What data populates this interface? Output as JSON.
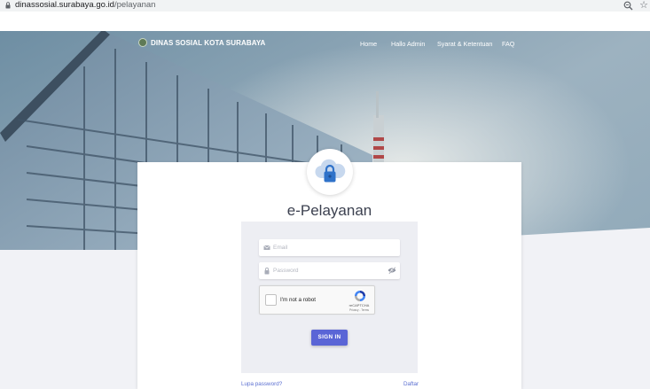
{
  "browser": {
    "url_host": "dinassosial.surabaya.go.id",
    "url_path": "/pelayanan",
    "icons": {
      "lock": "lock-icon",
      "zoom": "zoom-icon",
      "bookmark": "star-icon"
    }
  },
  "navbar": {
    "brand": "DINAS SOSIAL KOTA SURABAYA",
    "items": [
      "Home",
      "Hallo Admin",
      "Syarat & Ketentuan",
      "FAQ"
    ]
  },
  "login": {
    "logo_icon": "cloud-lock-icon",
    "title": "e-Pelayanan",
    "email_placeholder": "Email",
    "password_placeholder": "Password",
    "recaptcha": {
      "label": "I'm not a robot",
      "brand": "reCAPTCHA",
      "terms": "Privacy - Terms"
    },
    "signin_label": "SIGN IN",
    "forgot_password": "Lupa password?",
    "register": "Daftar"
  },
  "colors": {
    "accent": "#5a65d6",
    "link": "#5b6fd1",
    "page_bg": "#f1f2f6",
    "form_panel_bg": "#edeef3"
  }
}
